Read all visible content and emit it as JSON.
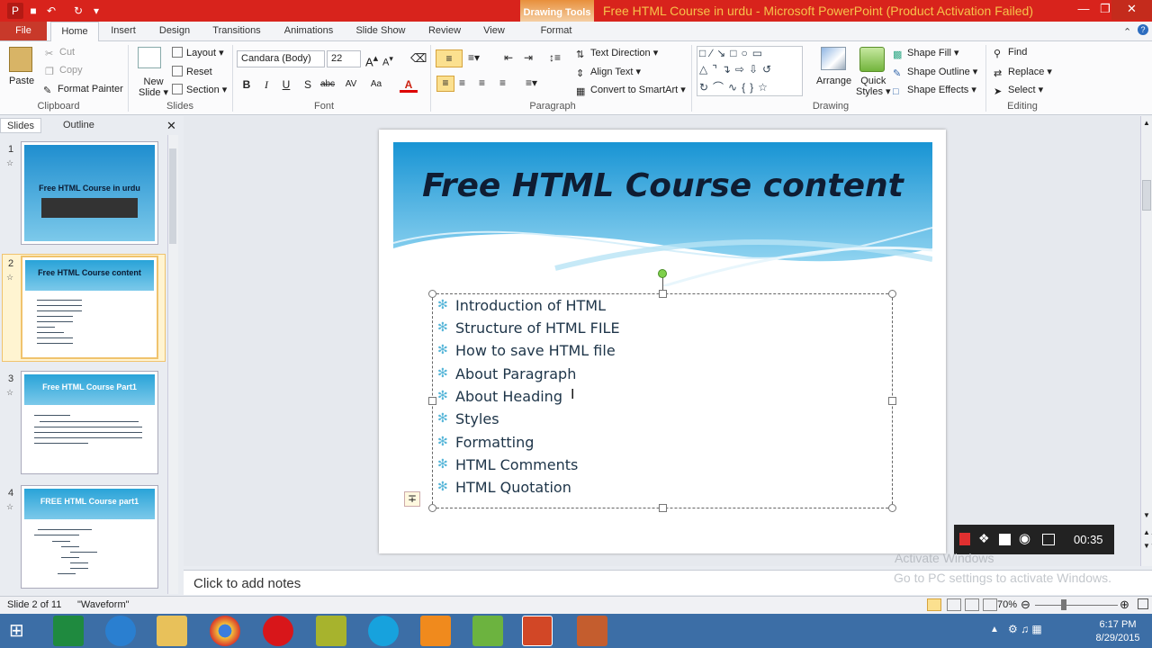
{
  "window": {
    "title": "Free HTML Course in urdu  -  Microsoft PowerPoint (Product Activation Failed)",
    "contextual_tab_group": "Drawing Tools"
  },
  "tabs": [
    "File",
    "Home",
    "Insert",
    "Design",
    "Transitions",
    "Animations",
    "Slide Show",
    "Review",
    "View",
    "Format"
  ],
  "active_tab": "Home",
  "ribbon": {
    "clipboard": {
      "paste": "Paste",
      "cut": "Cut",
      "copy": "Copy",
      "format_painter": "Format Painter",
      "label": "Clipboard"
    },
    "slides": {
      "new_slide_line1": "New",
      "new_slide_line2": "Slide",
      "layout": "Layout",
      "reset": "Reset",
      "section": "Section",
      "label": "Slides"
    },
    "font": {
      "name": "Candara (Body)",
      "size": "22",
      "label": "Font"
    },
    "paragraph": {
      "text_direction": "Text Direction",
      "align_text": "Align Text",
      "convert_smartart": "Convert to SmartArt",
      "label": "Paragraph"
    },
    "drawing": {
      "arrange": "Arrange",
      "quick_styles_line1": "Quick",
      "quick_styles_line2": "Styles",
      "shape_fill": "Shape Fill",
      "shape_outline": "Shape Outline",
      "shape_effects": "Shape Effects",
      "label": "Drawing"
    },
    "editing": {
      "find": "Find",
      "replace": "Replace",
      "select": "Select",
      "label": "Editing"
    }
  },
  "left_pane": {
    "tabs": [
      "Slides",
      "Outline"
    ],
    "slides": [
      {
        "num": "1",
        "title": "Free HTML Course in urdu"
      },
      {
        "num": "2",
        "title": "Free HTML Course content"
      },
      {
        "num": "3",
        "title": "Free HTML Course Part1"
      },
      {
        "num": "4",
        "title": "FREE HTML Course part1"
      }
    ]
  },
  "slide": {
    "title": "Free HTML Course content",
    "bullets": [
      "Introduction of HTML",
      "Structure of HTML FILE",
      "How to save HTML file",
      "About Paragraph",
      "About Heading",
      "Styles",
      "Formatting",
      "HTML Comments",
      "HTML Quotation"
    ]
  },
  "notes_placeholder": "Click to add notes",
  "status": {
    "slide_info": "Slide 2 of 11",
    "theme": "\"Waveform\"",
    "zoom": "70%"
  },
  "recorder": {
    "time": "00:35"
  },
  "watermark": {
    "line1": "Activate Windows",
    "line2": "Go to PC settings to activate Windows."
  },
  "taskbar": {
    "time": "6:17 PM",
    "date": "8/29/2015"
  },
  "colors": {
    "titlebar": "#d8231c",
    "file_tab": "#c8392a",
    "slide_blue": "#29a3d8",
    "taskbar": "#3c6ea6"
  }
}
